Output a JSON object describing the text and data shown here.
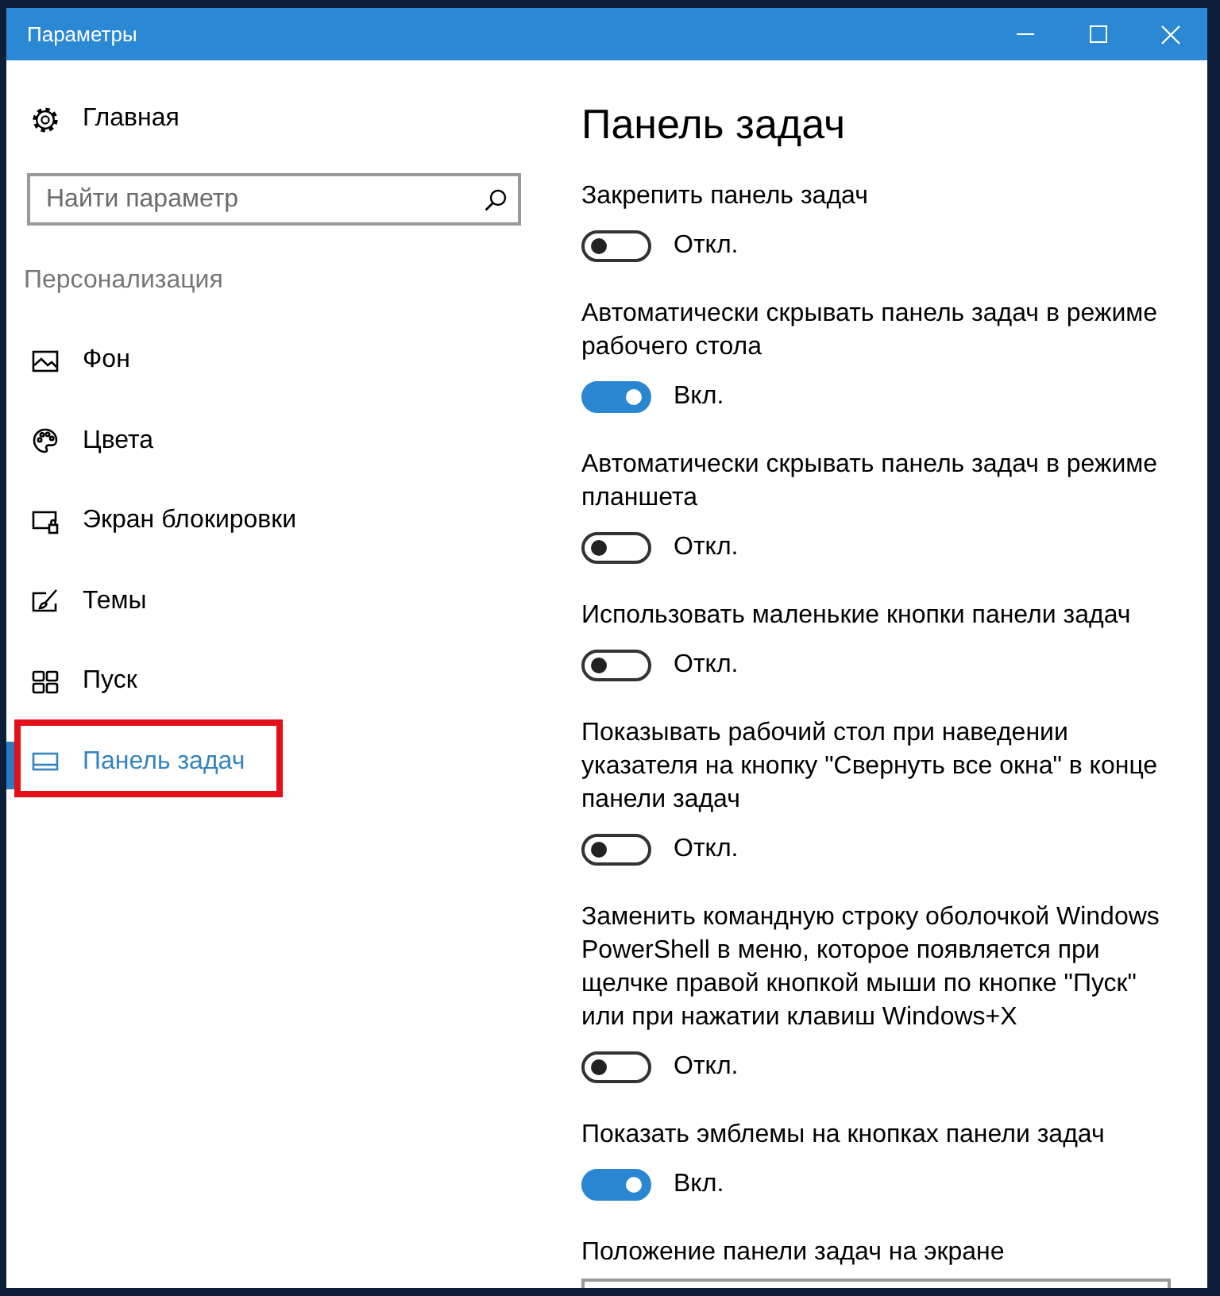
{
  "window": {
    "title": "Параметры"
  },
  "sidebar": {
    "home": {
      "label": "Главная"
    },
    "search": {
      "placeholder": "Найти параметр"
    },
    "section_title": "Персонализация",
    "items": [
      {
        "label": "Фон",
        "selected": false,
        "highlighted": false
      },
      {
        "label": "Цвета",
        "selected": false,
        "highlighted": false
      },
      {
        "label": "Экран блокировки",
        "selected": false,
        "highlighted": false
      },
      {
        "label": "Темы",
        "selected": false,
        "highlighted": false
      },
      {
        "label": "Пуск",
        "selected": false,
        "highlighted": false
      },
      {
        "label": "Панель задач",
        "selected": true,
        "highlighted": true
      }
    ]
  },
  "content": {
    "title": "Панель задач",
    "settings": [
      {
        "label": "Закрепить панель задач",
        "on": false,
        "state_text": "Откл."
      },
      {
        "label": "Автоматически скрывать панель задач в режиме рабочего стола",
        "on": true,
        "state_text": "Вкл."
      },
      {
        "label": "Автоматически скрывать панель задач в режиме планшета",
        "on": false,
        "state_text": "Откл."
      },
      {
        "label": "Использовать маленькие кнопки панели задач",
        "on": false,
        "state_text": "Откл."
      },
      {
        "label": "Показывать рабочий стол при наведении указателя на кнопку \"Свернуть все окна\" в конце панели задач",
        "on": false,
        "state_text": "Откл."
      },
      {
        "label": "Заменить командную строку оболочкой Windows PowerShell в меню, которое появляется при щелчке правой кнопкой мыши по кнопке \"Пуск\" или при нажатии клавиш Windows+X",
        "on": false,
        "state_text": "Откл."
      },
      {
        "label": "Показать эмблемы на кнопках панели задач",
        "on": true,
        "state_text": "Вкл."
      }
    ],
    "dropdown": {
      "label": "Положение панели задач на экране"
    }
  }
}
